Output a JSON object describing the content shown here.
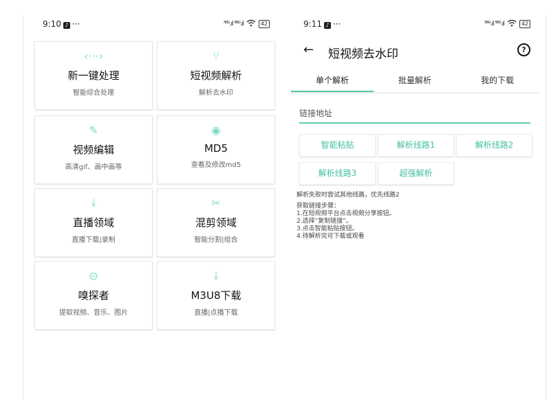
{
  "left": {
    "status": {
      "time": "9:10",
      "dots": "···",
      "signal": "⁵⁶ᴳ.ıl ⁵⁶ᴳ.ıl",
      "battery": "42"
    },
    "cards": [
      {
        "icon": "code-icon",
        "glyph": "‹···›",
        "title": "新一键处理",
        "subtitle": "智能综合处理"
      },
      {
        "icon": "fork-icon",
        "glyph": "⑂",
        "title": "短视频解析",
        "subtitle": "解析去水印"
      },
      {
        "icon": "pencil-icon",
        "glyph": "✎",
        "title": "视频编辑",
        "subtitle": "高清gif、画中画等"
      },
      {
        "icon": "target-icon",
        "glyph": "◉",
        "title": "MD5",
        "subtitle": "查看及修改md5"
      },
      {
        "icon": "download-icon",
        "glyph": "⤓",
        "title": "直播领域",
        "subtitle": "直播下载|录制"
      },
      {
        "icon": "scissors-icon",
        "glyph": "✂",
        "title": "混剪领域",
        "subtitle": "智能分割|组合"
      },
      {
        "icon": "link-icon",
        "glyph": "⊝",
        "title": "嗅探者",
        "subtitle": "提取视频、音乐、图片"
      },
      {
        "icon": "download-icon",
        "glyph": "⤓",
        "title": "M3U8下载",
        "subtitle": "直播|点播下载"
      }
    ]
  },
  "right": {
    "status": {
      "time": "9:11",
      "dots": "···",
      "signal": "⁵⁶ᴳ.ıl ⁵⁶ᴳ.ıl",
      "battery": "42"
    },
    "title": "短视频去水印",
    "tabs": [
      "单个解析",
      "批量解析",
      "我的下载"
    ],
    "active_tab": 0,
    "url_placeholder": "链接地址",
    "buttons": [
      "智能粘贴",
      "解析线路1",
      "解析线路2",
      "解析线路3",
      "超强解析"
    ],
    "tips": [
      "解析失败时尝试其他线路，优先线路2",
      "获取链接步骤：",
      "1.在短视频平台点击视频分享按钮。",
      "2.选择“复制链接”。",
      "3.点击智能粘贴按钮。",
      "4.待解析完可下载或观看"
    ],
    "accent": "#4fc3a8"
  }
}
